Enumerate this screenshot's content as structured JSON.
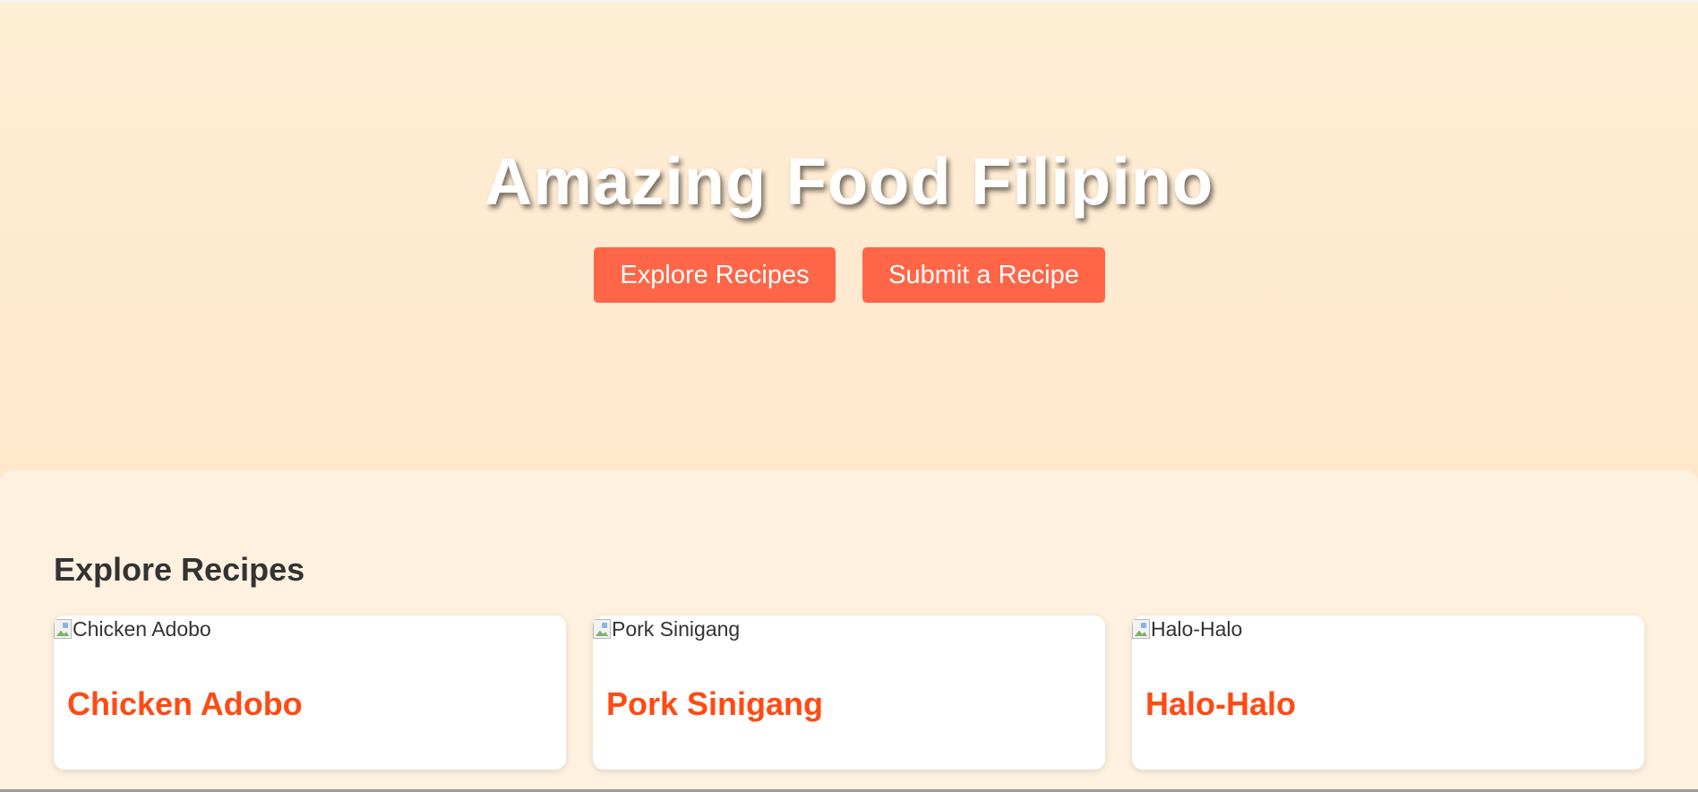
{
  "hero": {
    "title": "Amazing Food Filipino",
    "buttons": {
      "explore_label": "Explore Recipes",
      "submit_label": "Submit a Recipe"
    }
  },
  "explore": {
    "title": "Explore Recipes",
    "cards": [
      {
        "image_alt": "Chicken Adobo",
        "title": "Chicken Adobo"
      },
      {
        "image_alt": "Pork Sinigang",
        "title": "Pork Sinigang"
      },
      {
        "image_alt": "Halo-Halo",
        "title": "Halo-Halo"
      }
    ]
  },
  "colors": {
    "accent": "#ff6647",
    "card_title": "#ff4a14",
    "hero_bg": "#feeed5",
    "content_bg": "#fff1df"
  },
  "icons": {
    "card_image": "broken-image-icon"
  }
}
